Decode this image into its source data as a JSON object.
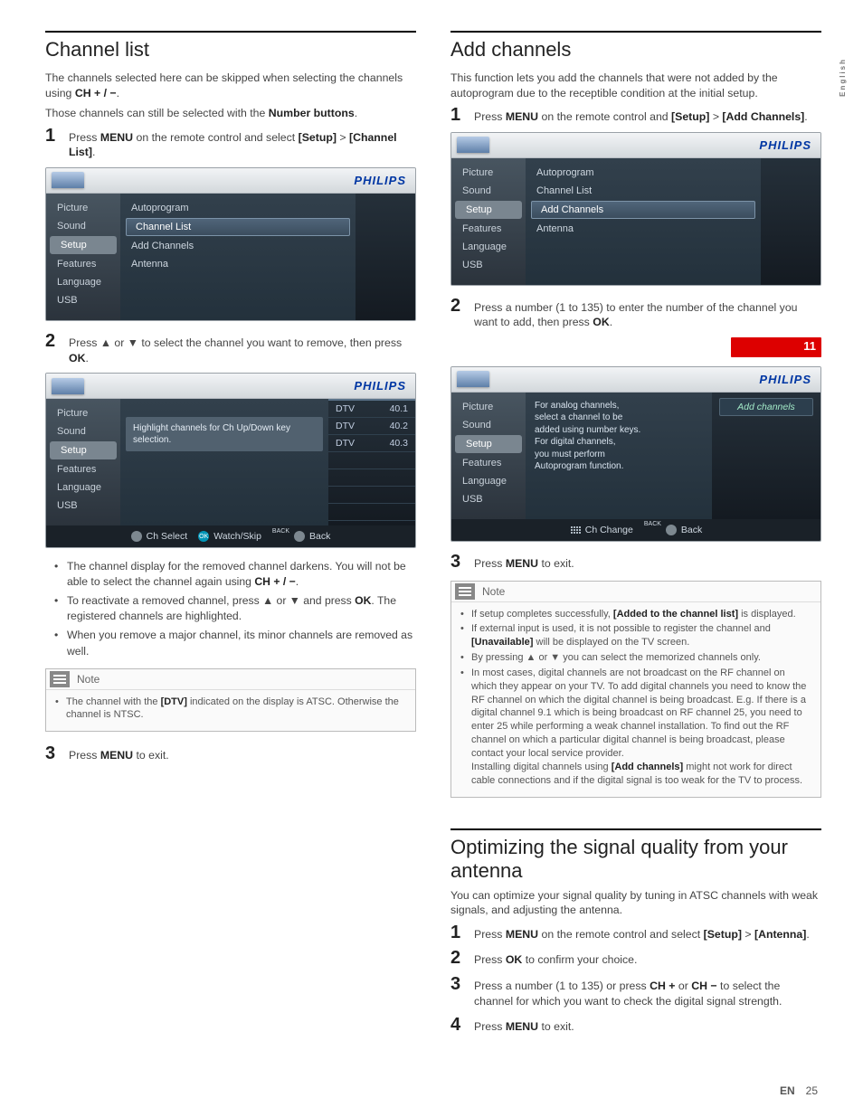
{
  "sideLang": "English",
  "footer": {
    "lang": "EN",
    "page": "25"
  },
  "brand": "PHILIPS",
  "left": {
    "channelList": {
      "title": "Channel list",
      "intro1_pre": "The channels selected here can be skipped when selecting the channels using ",
      "intro1_bold": "CH + / −",
      "intro1_post": ".",
      "intro2_pre": "Those channels can still be selected with the ",
      "intro2_bold": "Number buttons",
      "intro2_post": ".",
      "step1_a": "Press ",
      "step1_b": "MENU",
      "step1_c": " on the remote control and select ",
      "step1_d": "[Setup]",
      "step1_e": " > ",
      "step1_f": "[Channel List]",
      "step1_g": ".",
      "step2_a": "Press ▲ or ▼ to select the channel you want to remove, then press ",
      "step2_b": "OK",
      "step2_c": ".",
      "bullets": [
        {
          "a": "The channel display for the removed channel darkens. You will not be able to select the channel again using ",
          "b": "CH + / −",
          "c": "."
        },
        {
          "a": "To reactivate a removed channel, press ▲ or ▼ and press ",
          "b": "OK",
          "c": ". The registered channels are highlighted."
        },
        {
          "a": "When you remove a major channel, its minor channels are removed as well.",
          "b": "",
          "c": ""
        }
      ],
      "noteLabel": "Note",
      "noteItem_a": "The channel with the ",
      "noteItem_b": "[DTV]",
      "noteItem_c": " indicated on the display is ATSC. Otherwise the channel is NTSC.",
      "step3_a": "Press ",
      "step3_b": "MENU",
      "step3_c": " to exit."
    },
    "menu1": {
      "side": [
        "Picture",
        "Sound",
        "Setup",
        "Features",
        "Language",
        "USB"
      ],
      "sideSelected": "Setup",
      "mid": [
        "Autoprogram",
        "Channel List",
        "Add Channels",
        "Antenna"
      ],
      "midSelected": "Channel List"
    },
    "menu2": {
      "side": [
        "Picture",
        "Sound",
        "Setup",
        "Features",
        "Language",
        "USB"
      ],
      "sideSelected": "Setup",
      "tooltip": "Highlight channels for Ch Up/Down key selection.",
      "rows": [
        {
          "l": "DTV",
          "r": "40.1"
        },
        {
          "l": "DTV",
          "r": "40.2"
        },
        {
          "l": "DTV",
          "r": "40.3"
        }
      ],
      "footer": {
        "a": "Ch Select",
        "b": "Watch/Skip",
        "backLbl": "BACK",
        "back": "Back"
      }
    }
  },
  "right": {
    "addChannels": {
      "title": "Add channels",
      "intro": "This function lets you add the channels that were not added by the autoprogram due to the receptible condition at the initial setup.",
      "step1_a": "Press ",
      "step1_b": "MENU",
      "step1_c": " on the remote control and ",
      "step1_d": "[Setup]",
      "step1_e": " > ",
      "step1_f": "[Add Channels]",
      "step1_g": ".",
      "step2_a": "Press a number (1 to 135) to enter the number of the channel you want to add, then press ",
      "step2_b": "OK",
      "step2_c": ".",
      "step3_a": "Press ",
      "step3_b": "MENU",
      "step3_c": " to exit.",
      "noteLabel": "Note",
      "notes": [
        {
          "a": "If setup completes successfully, ",
          "b": "[Added to the channel list]",
          "c": " is displayed."
        },
        {
          "a": "If external input is used, it is not possible to register the channel and ",
          "b": "[Unavailable]",
          "c": " will be displayed on the TV screen."
        },
        {
          "a": "By pressing ▲ or ▼ you can select the memorized channels only.",
          "b": "",
          "c": ""
        },
        {
          "a": "In most cases, digital channels are not broadcast on the RF channel on which they appear on your TV. To add digital channels you need to know the RF channel on which the digital channel is being broadcast. E.g. If there is a digital channel 9.1 which is being broadcast on RF channel 25, you need to enter 25 while performing a weak channel installation. To find out the RF channel on which a particular digital channel is being broadcast, please contact your local service provider.\nInstalling digital channels using ",
          "b": "[Add channels]",
          "c": " might not work for direct cable connections and if the digital signal is too weak for the TV to process."
        }
      ]
    },
    "menu1": {
      "side": [
        "Picture",
        "Sound",
        "Setup",
        "Features",
        "Language",
        "USB"
      ],
      "sideSelected": "Setup",
      "mid": [
        "Autoprogram",
        "Channel List",
        "Add Channels",
        "Antenna"
      ],
      "midSelected": "Add Channels"
    },
    "numInput": "11",
    "menu2": {
      "side": [
        "Picture",
        "Sound",
        "Setup",
        "Features",
        "Language",
        "USB"
      ],
      "sideSelected": "Setup",
      "tips": "For analog channels,\nselect a channel to be\nadded using number keys.\nFor digital channels,\nyou must perform\nAutoprogram function.",
      "rightLabel": "Add channels",
      "footer": {
        "a": "Ch Change",
        "backLbl": "BACK",
        "back": "Back"
      }
    },
    "optimize": {
      "title": "Optimizing the signal quality from your antenna",
      "intro": "You can optimize your signal quality by tuning in ATSC channels with weak signals, and adjusting the antenna.",
      "s1_a": "Press ",
      "s1_b": "MENU",
      "s1_c": " on the remote control and select ",
      "s1_d": "[Setup]",
      "s1_e": " > ",
      "s1_f": "[Antenna]",
      "s1_g": ".",
      "s2_a": "Press ",
      "s2_b": "OK",
      "s2_c": " to confirm your choice.",
      "s3_a": "Press a number (1 to 135) or press ",
      "s3_b": "CH +",
      "s3_c": " or ",
      "s3_d": "CH −",
      "s3_e": " to select the channel for which you want to check the digital signal strength.",
      "s4_a": "Press ",
      "s4_b": "MENU",
      "s4_c": " to exit."
    }
  }
}
